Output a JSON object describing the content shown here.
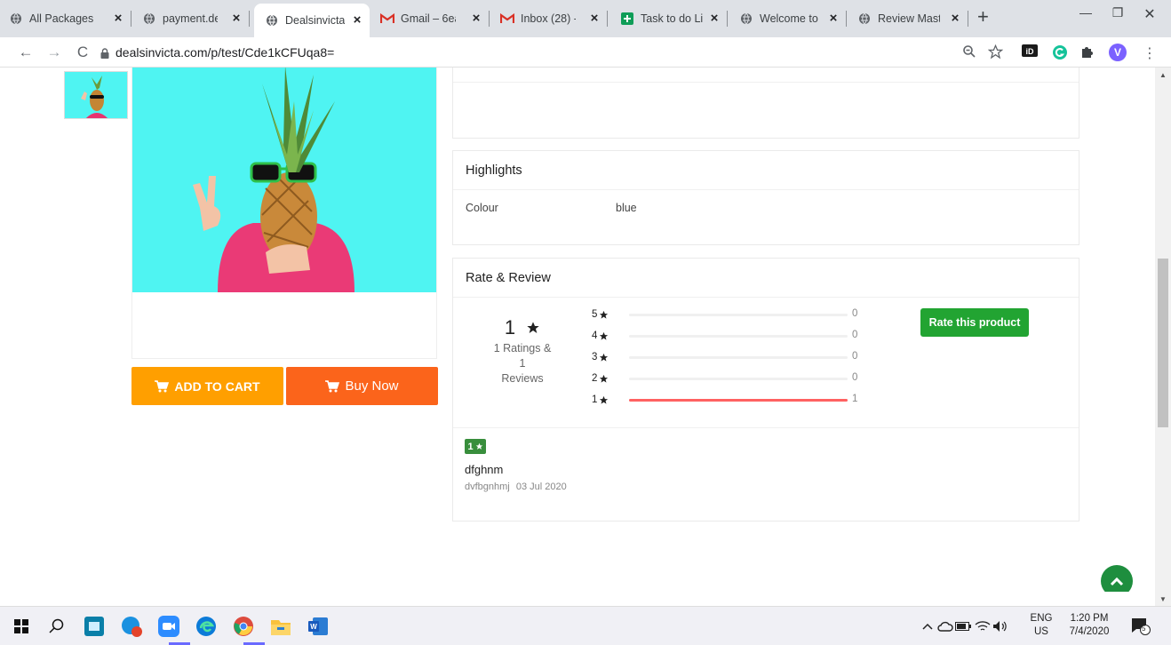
{
  "tabs": [
    {
      "title": "All Packages",
      "active": false,
      "icon": "globe-icon"
    },
    {
      "title": "payment.dea",
      "active": false,
      "icon": "globe-icon"
    },
    {
      "title": "Dealsinvicta",
      "active": true,
      "icon": "globe-icon"
    },
    {
      "title": "Gmail – 6ea",
      "active": false,
      "icon": "gmail-icon"
    },
    {
      "title": "Inbox (28) -",
      "active": false,
      "icon": "gmail-icon"
    },
    {
      "title": "Task to do Li",
      "active": false,
      "icon": "sheets-icon"
    },
    {
      "title": "Welcome to",
      "active": false,
      "icon": "globe-icon"
    },
    {
      "title": "Review Mast",
      "active": false,
      "icon": "globe-icon"
    }
  ],
  "browser": {
    "url": "dealsinvicta.com/p/test/Cde1kCFUqa8=",
    "profile_initial": "V"
  },
  "product": {
    "add_to_cart_label": "ADD TO CART",
    "buy_now_label": "Buy Now"
  },
  "highlights": {
    "title": "Highlights",
    "rows": [
      {
        "key": "Colour",
        "value": "blue"
      }
    ]
  },
  "rating": {
    "title": "Rate & Review",
    "overall": "1",
    "summary_line1": "1 Ratings & 1",
    "summary_line2": "Reviews",
    "rate_button": "Rate this product",
    "breakdown": [
      {
        "stars": "5",
        "count": "0",
        "fraction": 0
      },
      {
        "stars": "4",
        "count": "0",
        "fraction": 0
      },
      {
        "stars": "3",
        "count": "0",
        "fraction": 0
      },
      {
        "stars": "2",
        "count": "0",
        "fraction": 0
      },
      {
        "stars": "1",
        "count": "1",
        "fraction": 1
      }
    ]
  },
  "review": {
    "badge": "1",
    "title": "dfghnm",
    "author": "dvfbgnhmj",
    "date": "03 Jul 2020"
  },
  "taskbar": {
    "language_line1": "ENG",
    "language_line2": "US",
    "time": "1:20 PM",
    "date": "7/4/2020",
    "notification_count": "5"
  },
  "colors": {
    "add_to_cart": "#ff9f00",
    "buy_now": "#fb641b",
    "rate_button": "#22a432",
    "review_badge": "#388e3c",
    "bar_fill": "#ff6161"
  }
}
